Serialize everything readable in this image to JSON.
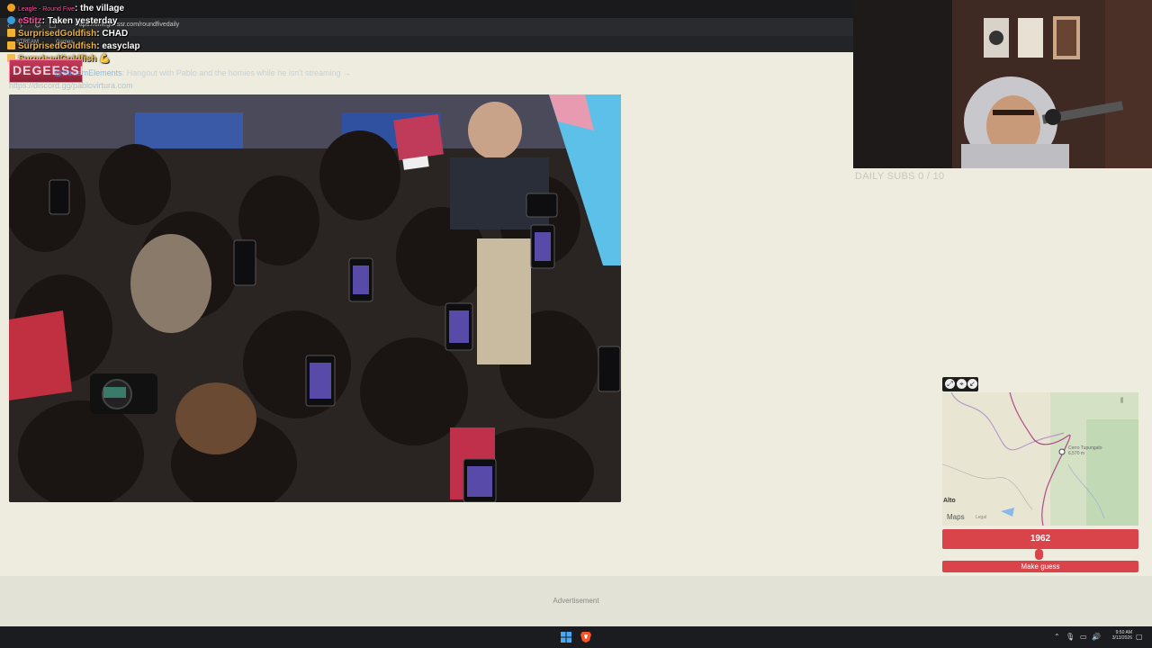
{
  "browser": {
    "tab_title": "Leagle - Round Five",
    "url": "https://timeguessr.com/roundfivedaily",
    "bookmarks": [
      "STREAM",
      "Games"
    ]
  },
  "chat": [
    {
      "user": "",
      "message": ": the village",
      "user_color": "#ff4fa3"
    },
    {
      "user": "eStitz",
      "message": ": Taken yesterday",
      "user_color": "#ff4fa3"
    },
    {
      "user": "SurprisedGoldfish",
      "message": ": CHAD",
      "user_color": "#f0b232"
    },
    {
      "user": "SurprisedGoldfish",
      "message": ": easyclap",
      "user_color": "#f0b232"
    },
    {
      "user": "SurprisedGoldfish",
      "message": "",
      "user_color": "#f0b232"
    }
  ],
  "overlay": {
    "logo_text": "DEGEESSI",
    "stream_elements": "@StreamElements",
    "stream_elements_msg": ": Hangout with Pablo and the homies while he isn't streaming →",
    "discord_link": "https://discord.gg/pablovirtura.com"
  },
  "webcam": {
    "daily_subs": "DAILY SUBS 0 / 10"
  },
  "map": {
    "place_label": "Alto",
    "pin_label": "Cerro Tupungato\n6,570 m",
    "brand": "Maps",
    "legal": "Legal"
  },
  "guess": {
    "year": "1962",
    "slider_fraction": 0.49,
    "button_label": "Make guess"
  },
  "footer": {
    "ad_label": "Advertisement"
  },
  "taskbar": {
    "time": "9:50 AM",
    "date": "3/13/2026"
  },
  "colors": {
    "accent_red": "#d9444a",
    "page_bg": "#edecde"
  }
}
